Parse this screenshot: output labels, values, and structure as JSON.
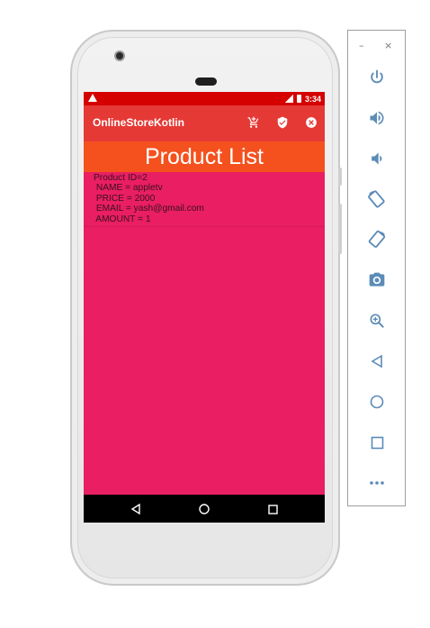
{
  "device": {
    "name": "pixel-phone"
  },
  "status_bar": {
    "time": "3:34"
  },
  "app_bar": {
    "title": "OnlineStoreKotlin",
    "actions": [
      "cart-add-icon",
      "verified-shield-icon",
      "close-circle-icon"
    ]
  },
  "page": {
    "heading": "Product List"
  },
  "products": [
    {
      "id_line": "Product ID=2",
      "name_line": " NAME = appletv",
      "price_line": " PRICE = 2000",
      "email_line": " EMAIL = yash@gmail.com",
      "amount_line": " AMOUNT = 1"
    }
  ],
  "navigation": [
    "back-icon",
    "home-icon",
    "recents-icon"
  ],
  "emulator_toolbar": {
    "window_controls": {
      "minimize": "–",
      "close": "×"
    },
    "buttons": [
      "power-icon",
      "volume-up-icon",
      "volume-down-icon",
      "rotate-left-icon",
      "rotate-right-icon",
      "camera-icon",
      "zoom-icon",
      "back-icon",
      "home-icon",
      "overview-icon",
      "more-icon"
    ]
  },
  "colors": {
    "status_bar": "#d50000",
    "app_bar": "#e53935",
    "heading_bar": "#f4511e",
    "content_bg": "#e91e63",
    "toolbar_icon": "#5b8bb7"
  }
}
